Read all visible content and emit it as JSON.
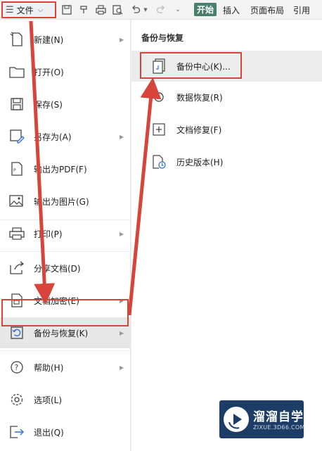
{
  "toolbar": {
    "file_label": "文件",
    "start_tab": "开始",
    "tabs": [
      "插入",
      "页面布局",
      "引用"
    ]
  },
  "left_menu": {
    "items": [
      {
        "label": "新建(N)",
        "icon": "new-file-icon",
        "has_arrow": true
      },
      {
        "label": "打开(O)",
        "icon": "folder-icon",
        "has_arrow": false
      },
      {
        "label": "保存(S)",
        "icon": "save-icon",
        "has_arrow": false
      },
      {
        "label": "另存为(A)",
        "icon": "save-as-icon",
        "has_arrow": true
      },
      {
        "label": "输出为PDF(F)",
        "icon": "pdf-export-icon",
        "has_arrow": false
      },
      {
        "label": "输出为图片(G)",
        "icon": "image-export-icon",
        "has_arrow": false
      },
      {
        "label": "打印(P)",
        "icon": "print-icon",
        "has_arrow": true
      },
      {
        "label": "分享文档(D)",
        "icon": "share-icon",
        "has_arrow": false
      },
      {
        "label": "文档加密(E)",
        "icon": "lock-document-icon",
        "has_arrow": true
      },
      {
        "label": "备份与恢复(K)",
        "icon": "backup-restore-icon",
        "has_arrow": true,
        "selected": true
      },
      {
        "label": "帮助(H)",
        "icon": "help-icon",
        "has_arrow": true
      },
      {
        "label": "选项(L)",
        "icon": "settings-icon",
        "has_arrow": false
      },
      {
        "label": "退出(Q)",
        "icon": "exit-icon",
        "has_arrow": false
      }
    ]
  },
  "right_panel": {
    "title": "备份与恢复",
    "items": [
      {
        "label": "备份中心(K)...",
        "icon": "backup-center-icon"
      },
      {
        "label": "数据恢复(R)",
        "icon": "data-recovery-icon"
      },
      {
        "label": "文档修复(F)",
        "icon": "document-repair-icon"
      },
      {
        "label": "历史版本(H)",
        "icon": "history-version-icon"
      }
    ]
  },
  "watermark": {
    "title": "溜溜自学",
    "url": "ZIXUE.3D66.COM"
  },
  "colors": {
    "highlight_red": "#d8433a",
    "start_tab_green": "#49806a",
    "watermark_blue": "#1e3d66"
  }
}
